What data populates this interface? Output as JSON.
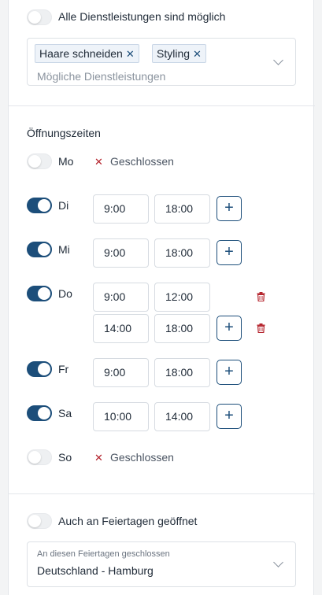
{
  "services": {
    "all_possible_label": "Alle Dienstleistungen sind möglich",
    "all_possible_on": false,
    "chips": [
      {
        "label": "Haare schneiden",
        "remove_glyph": "✕"
      },
      {
        "label": "Styling",
        "remove_glyph": "✕"
      }
    ],
    "placeholder": "Mögliche Dienstleistungen"
  },
  "hours": {
    "title": "Öffnungszeiten",
    "closed_label": "Geschlossen",
    "closed_glyph": "✕",
    "add_glyph": "+",
    "days": [
      {
        "label": "Mo",
        "open": false,
        "slots": []
      },
      {
        "label": "Di",
        "open": true,
        "slots": [
          {
            "from": "9:00",
            "to": "18:00"
          }
        ]
      },
      {
        "label": "Mi",
        "open": true,
        "slots": [
          {
            "from": "9:00",
            "to": "18:00"
          }
        ]
      },
      {
        "label": "Do",
        "open": true,
        "slots": [
          {
            "from": "9:00",
            "to": "12:00"
          },
          {
            "from": "14:00",
            "to": "18:00"
          }
        ]
      },
      {
        "label": "Fr",
        "open": true,
        "slots": [
          {
            "from": "9:00",
            "to": "18:00"
          }
        ]
      },
      {
        "label": "Sa",
        "open": true,
        "slots": [
          {
            "from": "10:00",
            "to": "14:00"
          }
        ]
      },
      {
        "label": "So",
        "open": false,
        "slots": []
      }
    ]
  },
  "holidays": {
    "open_label": "Auch an Feiertagen geöffnet",
    "open_on": false,
    "select_label": "An diesen Feiertagen geschlossen",
    "select_value": "Deutschland - Hamburg"
  },
  "colors": {
    "accent": "#1c4e7a",
    "danger": "#b4232c",
    "border": "#dde1e6"
  },
  "icons": {
    "chevron": "chevron-down-icon",
    "trash": "trash-icon",
    "close": "close-icon",
    "plus": "plus-icon"
  }
}
